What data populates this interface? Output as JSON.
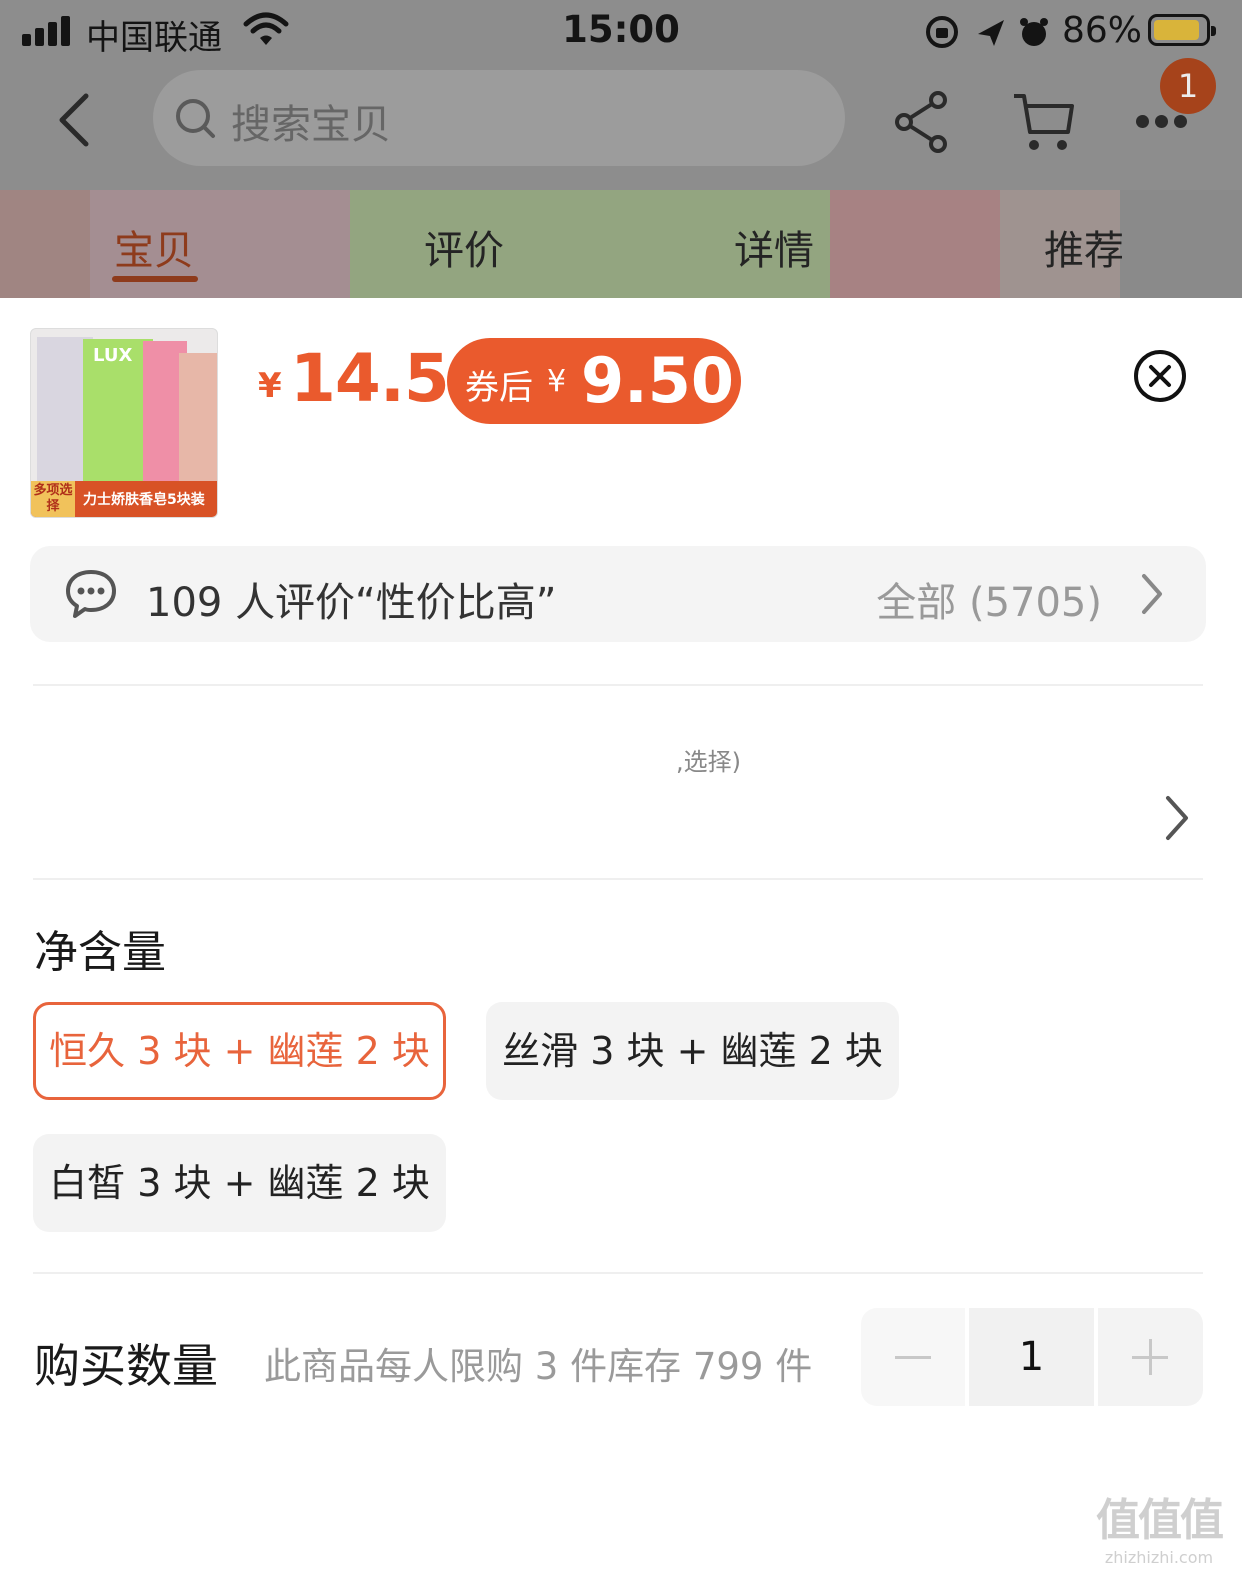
{
  "status_bar": {
    "carrier": "中国联通",
    "time": "15:00",
    "battery_percent": "86%",
    "battery_level": 0.86
  },
  "nav": {
    "search_placeholder": "搜索宝贝",
    "cart_badge": "1",
    "icons": [
      "back-arrow-icon",
      "search-icon",
      "share-icon",
      "cart-icon",
      "more-icon"
    ]
  },
  "tabs": [
    {
      "label": "宝贝",
      "active": true
    },
    {
      "label": "评价",
      "active": false
    },
    {
      "label": "详情",
      "active": false
    },
    {
      "label": "推荐",
      "active": false
    }
  ],
  "product": {
    "thumb_brand": "LUX",
    "thumb_badge": "多项选择",
    "thumb_caption": "力士娇肤香皂5块装",
    "price_symbol": "¥",
    "price": "14.5",
    "coupon_label": "券后",
    "coupon_symbol": "¥",
    "coupon_price": "9.50"
  },
  "review": {
    "summary": "109 人评价“性价比高”",
    "all_label": "全部 (5705)"
  },
  "address": {
    "partial_text": ",选择)"
  },
  "spec": {
    "title": "净含量",
    "options": [
      {
        "label": "恒久 3 块 + 幽莲 2 块",
        "selected": true
      },
      {
        "label": "丝滑 3 块 + 幽莲 2 块",
        "selected": false
      },
      {
        "label": "白皙 3 块 + 幽莲 2 块",
        "selected": false
      }
    ]
  },
  "quantity": {
    "title": "购买数量",
    "note": "此商品每人限购 3 件库存 799 件",
    "value": "1"
  },
  "watermark": {
    "logo": "值值值",
    "domain": "zhizhizhi.com"
  },
  "colors": {
    "accent": "#ea5a2d",
    "selected_border": "#e8643c",
    "overlay": "#8d8d8d"
  }
}
